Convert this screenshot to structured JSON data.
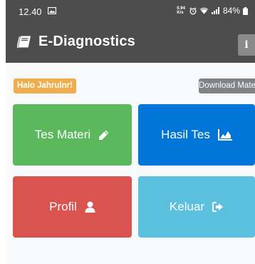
{
  "status_bar": {
    "time": "12.40",
    "net_speed_value": "0.94",
    "net_speed_unit": "K/s",
    "battery": "84%"
  },
  "app_bar": {
    "title": "E-Diagnostics",
    "info_label": "i"
  },
  "greeting": "Halo Jahrulnr!",
  "download_button": "Download Materi",
  "menu": [
    {
      "label": "Tes Materi",
      "icon": "pencil-icon",
      "color": "#5cb85c"
    },
    {
      "label": "Hasil Tes",
      "icon": "area-chart-icon",
      "color": "#0275d8"
    },
    {
      "label": "Profil",
      "icon": "user-icon",
      "color": "#d9534f"
    },
    {
      "label": "Keluar",
      "icon": "sign-out-icon",
      "color": "#5bc0de"
    }
  ],
  "colors": {
    "app_bar": "#4d4d4d",
    "greeting_badge": "#f0ad4e",
    "download_button": "#7f8385"
  }
}
